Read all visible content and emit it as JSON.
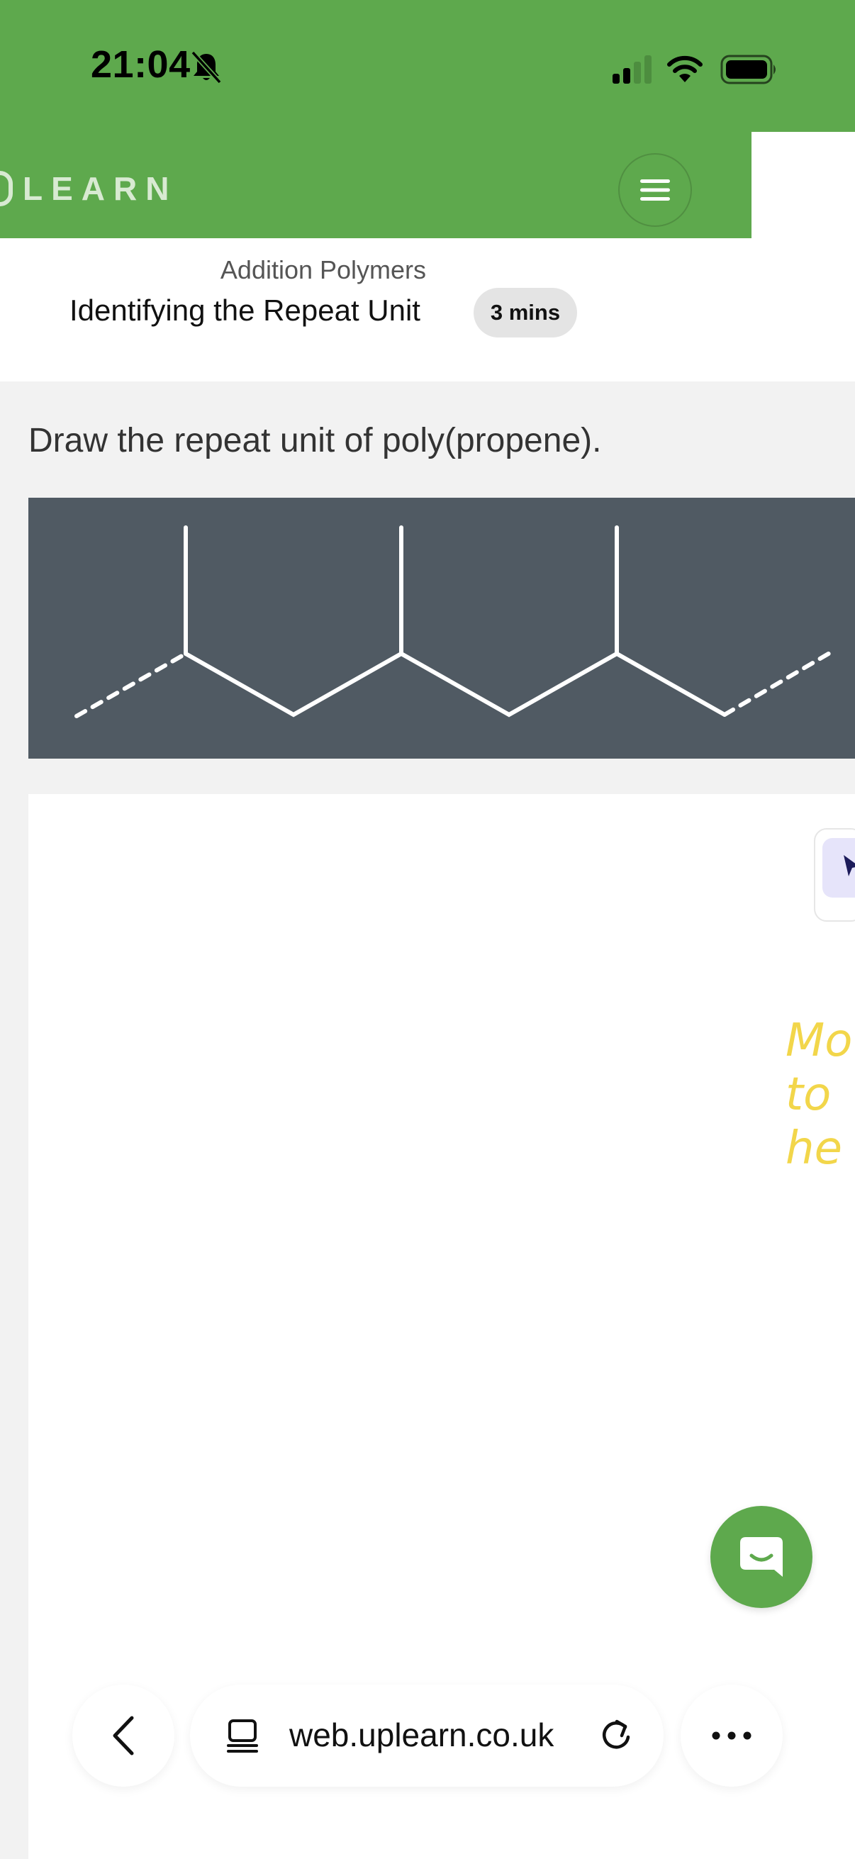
{
  "status_bar": {
    "time": "21:04",
    "icons": [
      "bell-muted-icon",
      "signal-icon",
      "wifi-icon",
      "battery-icon"
    ]
  },
  "header": {
    "brand": "LEARN",
    "menu_icon": "hamburger-menu-icon",
    "colors": {
      "brand_green": "#5ea94d",
      "brand_text": "#d8ead2"
    }
  },
  "lesson": {
    "topic": "Addition Polymers",
    "title": "Identifying the Repeat Unit",
    "duration": "3 mins"
  },
  "question": {
    "text": "Draw the repeat unit of poly(propene).",
    "figure_background": "#505a63"
  },
  "canvas": {
    "tool_icon": "cursor-icon",
    "hint_lines": [
      "Mo",
      "to",
      "he"
    ],
    "hint_color": "#f2d64a"
  },
  "chat": {
    "icon": "chat-bubble-icon"
  },
  "browser": {
    "back_icon": "chevron-left-icon",
    "url": "web.uplearn.co.uk",
    "page_icon": "page-icon",
    "reload_icon": "reload-icon",
    "more_icon": "ellipsis-icon"
  }
}
